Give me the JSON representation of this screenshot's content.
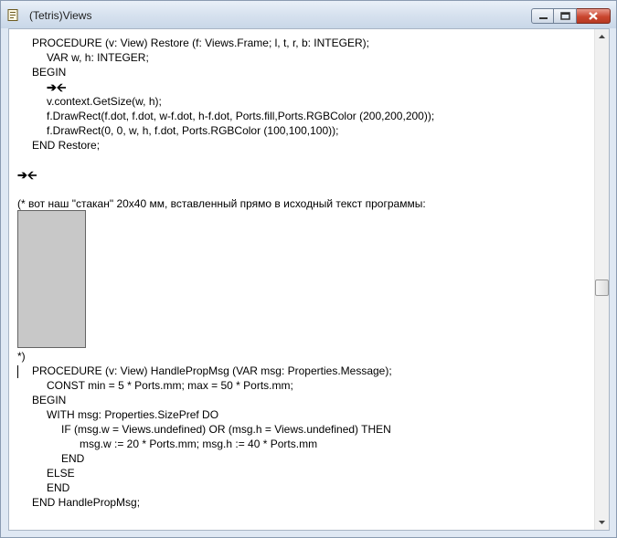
{
  "window": {
    "title": "(Tetris)Views"
  },
  "code_lines": [
    "PROCEDURE (v: View) Restore (f: Views.Frame; l, t, r, b: INTEGER);",
    "VAR w, h: INTEGER;",
    "BEGIN",
    "v.context.GetSize(w, h);",
    "f.DrawRect(f.dot, f.dot, w-f.dot, h-f.dot, Ports.fill,Ports.RGBColor (200,200,200));",
    "f.DrawRect(0, 0, w, h, f.dot, Ports.RGBColor (100,100,100));",
    "END Restore;",
    "(* вот наш \"стакан\" 20x40 мм, вставленный прямо в исходный текст программы:",
    "*)",
    "PROCEDURE (v: View) HandlePropMsg (VAR msg: Properties.Message);",
    "CONST min = 5 * Ports.mm; max = 50 * Ports.mm;",
    "BEGIN",
    "WITH msg: Properties.SizePref DO",
    "IF (msg.w = Views.undefined) OR (msg.h = Views.undefined) THEN",
    "msg.w := 20 * Ports.mm; msg.h := 40 * Ports.mm",
    "END",
    "ELSE",
    "END",
    "END HandlePropMsg;"
  ],
  "fold_marker": "➔🡨",
  "embedded_view": {
    "fill_color": "#c8c8c8",
    "border_color": "#646464"
  },
  "colors": {
    "close_button": "#c9462f",
    "titlebar": "#d7e2ef"
  }
}
